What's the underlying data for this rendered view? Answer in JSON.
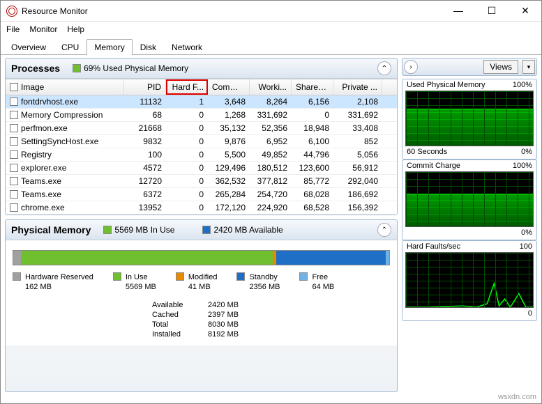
{
  "window": {
    "title": "Resource Monitor"
  },
  "menu": {
    "file": "File",
    "monitor": "Monitor",
    "help": "Help"
  },
  "tabs": {
    "overview": "Overview",
    "cpu": "CPU",
    "memory": "Memory",
    "disk": "Disk",
    "network": "Network"
  },
  "processes": {
    "title": "Processes",
    "summary": "69% Used Physical Memory",
    "summary_color": "#6fbf2e",
    "columns": {
      "image": "Image",
      "pid": "PID",
      "hard": "Hard F...",
      "commit": "Commi...",
      "working": "Worki...",
      "share": "Sharea...",
      "private": "Private ..."
    },
    "rows": [
      {
        "image": "fontdrvhost.exe",
        "pid": "11132",
        "hard": "1",
        "commit": "3,648",
        "working": "8,264",
        "share": "6,156",
        "private": "2,108",
        "selected": true
      },
      {
        "image": "Memory Compression",
        "pid": "68",
        "hard": "0",
        "commit": "1,268",
        "working": "331,692",
        "share": "0",
        "private": "331,692"
      },
      {
        "image": "perfmon.exe",
        "pid": "21668",
        "hard": "0",
        "commit": "35,132",
        "working": "52,356",
        "share": "18,948",
        "private": "33,408"
      },
      {
        "image": "SettingSyncHost.exe",
        "pid": "9832",
        "hard": "0",
        "commit": "9,876",
        "working": "6,952",
        "share": "6,100",
        "private": "852"
      },
      {
        "image": "Registry",
        "pid": "100",
        "hard": "0",
        "commit": "5,500",
        "working": "49,852",
        "share": "44,796",
        "private": "5,056"
      },
      {
        "image": "explorer.exe",
        "pid": "4572",
        "hard": "0",
        "commit": "129,496",
        "working": "180,512",
        "share": "123,600",
        "private": "56,912"
      },
      {
        "image": "Teams.exe",
        "pid": "12720",
        "hard": "0",
        "commit": "362,532",
        "working": "377,812",
        "share": "85,772",
        "private": "292,040"
      },
      {
        "image": "Teams.exe",
        "pid": "6372",
        "hard": "0",
        "commit": "265,284",
        "working": "254,720",
        "share": "68,028",
        "private": "186,692"
      },
      {
        "image": "chrome.exe",
        "pid": "13952",
        "hard": "0",
        "commit": "172,120",
        "working": "224,920",
        "share": "68,528",
        "private": "156,392"
      }
    ]
  },
  "physmem": {
    "title": "Physical Memory",
    "inuse_summary": "5569 MB In Use",
    "available_summary": "2420 MB Available",
    "bar": [
      {
        "color": "#a0a0a0",
        "pct": 2
      },
      {
        "color": "#6fbf2e",
        "pct": 67
      },
      {
        "color": "#e68a00",
        "pct": 1
      },
      {
        "color": "#1f6fc7",
        "pct": 29
      },
      {
        "color": "#6fb2e8",
        "pct": 1
      }
    ],
    "legend": [
      {
        "color": "#a0a0a0",
        "label": "Hardware Reserved",
        "val": "162 MB"
      },
      {
        "color": "#6fbf2e",
        "label": "In Use",
        "val": "5569 MB"
      },
      {
        "color": "#e68a00",
        "label": "Modified",
        "val": "41 MB"
      },
      {
        "color": "#1f6fc7",
        "label": "Standby",
        "val": "2356 MB"
      },
      {
        "color": "#6fb2e8",
        "label": "Free",
        "val": "64 MB"
      }
    ],
    "stats": {
      "available_l": "Available",
      "available_v": "2420 MB",
      "cached_l": "Cached",
      "cached_v": "2397 MB",
      "total_l": "Total",
      "total_v": "8030 MB",
      "installed_l": "Installed",
      "installed_v": "8192 MB"
    }
  },
  "right": {
    "views": "Views",
    "graphs": [
      {
        "title": "Used Physical Memory",
        "max": "100%",
        "foot_l": "60 Seconds",
        "foot_r": "0%",
        "fill": 69
      },
      {
        "title": "Commit Charge",
        "max": "100%",
        "foot_l": "",
        "foot_r": "0%",
        "fill": 60
      },
      {
        "title": "Hard Faults/sec",
        "max": "100",
        "foot_l": "",
        "foot_r": "0",
        "spark": true
      }
    ]
  },
  "watermark": "wsxdn.com"
}
